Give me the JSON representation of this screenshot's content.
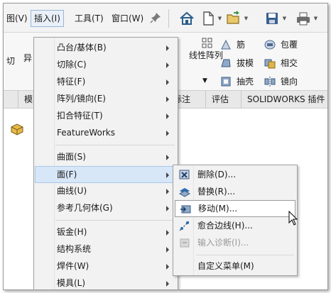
{
  "menubar": {
    "items": [
      {
        "label": "图(V)"
      },
      {
        "label": "插入(I)"
      },
      {
        "label": "工具(T)"
      },
      {
        "label": "窗口(W)"
      }
    ]
  },
  "ribbon": {
    "left_labels": [
      "切",
      "异"
    ],
    "features": {
      "linear_pattern": "线性阵列",
      "rib": "筋",
      "wrap": "包覆",
      "draft": "拔模",
      "intersect": "相交",
      "shell": "抽壳",
      "mirror": "镜向"
    }
  },
  "tabs": [
    "模",
    "标注",
    "评估",
    "SOLIDWORKS 插件"
  ],
  "insert_menu": {
    "items": [
      {
        "label": "凸台/基体(B)",
        "submenu": true
      },
      {
        "label": "切除(C)",
        "submenu": true
      },
      {
        "label": "特征(F)",
        "submenu": true
      },
      {
        "label": "阵列/镜向(E)",
        "submenu": true
      },
      {
        "label": "扣合特征(T)",
        "submenu": true
      },
      {
        "label": "FeatureWorks",
        "submenu": true
      },
      {
        "label": "曲面(S)",
        "submenu": true
      },
      {
        "label": "面(F)",
        "submenu": true,
        "highlighted": true
      },
      {
        "label": "曲线(U)",
        "submenu": true
      },
      {
        "label": "参考几何体(G)",
        "submenu": true
      },
      {
        "label": "钣金(H)",
        "submenu": true
      },
      {
        "label": "结构系统",
        "submenu": true
      },
      {
        "label": "焊件(W)",
        "submenu": true
      },
      {
        "label": "模具(L)",
        "submenu": true
      }
    ]
  },
  "face_submenu": {
    "items": [
      {
        "label": "删除(D)...",
        "icon": "delete-face-icon"
      },
      {
        "label": "替换(R)...",
        "icon": "replace-face-icon"
      },
      {
        "label": "移动(M)...",
        "icon": "move-face-icon",
        "highlighted": true
      },
      {
        "label": "愈合边线(H)...",
        "icon": "heal-edges-icon"
      },
      {
        "label": "输入诊断(I)...",
        "icon": "import-diagnostics-icon",
        "disabled": true
      },
      {
        "label": "自定义菜单(M)",
        "icon": ""
      }
    ]
  },
  "colors": {
    "highlight": "#d7e7f8",
    "highlight_border": "#a9c8ea",
    "menu_bg": "#f2f2f2",
    "disabled_text": "#9a9a9a",
    "accent_blue": "#2b6cb0"
  }
}
